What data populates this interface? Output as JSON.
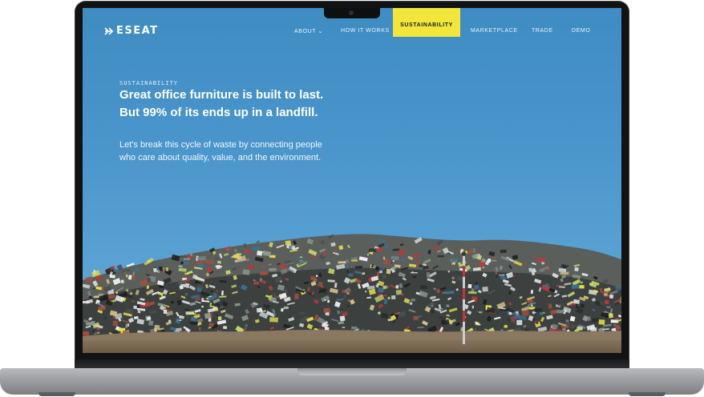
{
  "brand": {
    "name": "ESEAT"
  },
  "nav": {
    "items": [
      {
        "label": "ABOUT ⌄"
      },
      {
        "label": "HOW IT WORKS"
      },
      {
        "label": "SUSTAINABILITY",
        "active": true
      },
      {
        "label": "MARKETPLACE"
      },
      {
        "label": "TRADE"
      },
      {
        "label": "DEMO"
      }
    ]
  },
  "hero": {
    "eyebrow": "SUSTAINABILITY",
    "headline_line1": "Great office furniture is built to last.",
    "headline_line2": "But 99% of its ends up in a landfill.",
    "body_line1": "Let's break this cycle of waste by connecting people",
    "body_line2": "who care about quality, value, and the environment."
  },
  "colors": {
    "sky": "#3f8cc3",
    "accent_yellow": "#f2e63b",
    "text": "#ffffff"
  },
  "icons": [
    "logo-mark-icon",
    "camera-icon",
    "landfill-image"
  ]
}
